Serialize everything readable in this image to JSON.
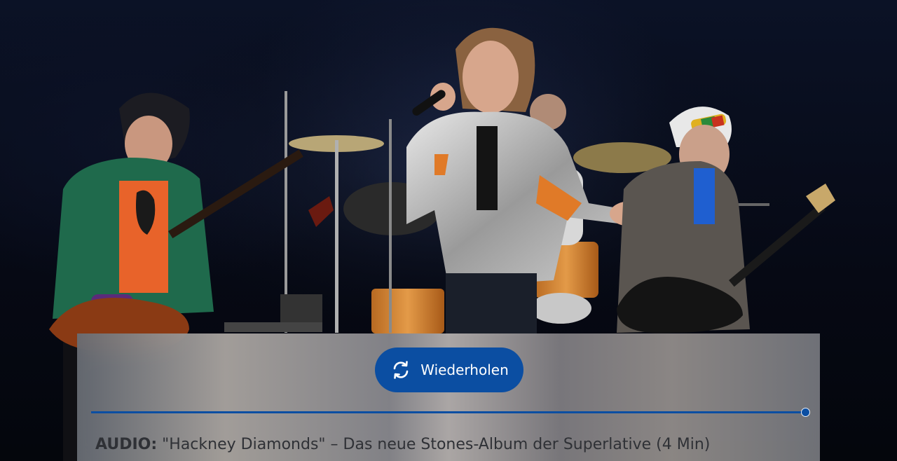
{
  "player": {
    "replay_label": "Wiederholen",
    "progress_fraction": 1.0,
    "caption_prefix": "AUDIO:",
    "caption_text": " \"Hackney Diamonds\" – Das neue Stones-Album der Superlative (4 Min)"
  },
  "icons": {
    "replay": "replay-icon"
  },
  "colors": {
    "accent": "#0b4ea2",
    "caption_text": "#2f3136"
  }
}
